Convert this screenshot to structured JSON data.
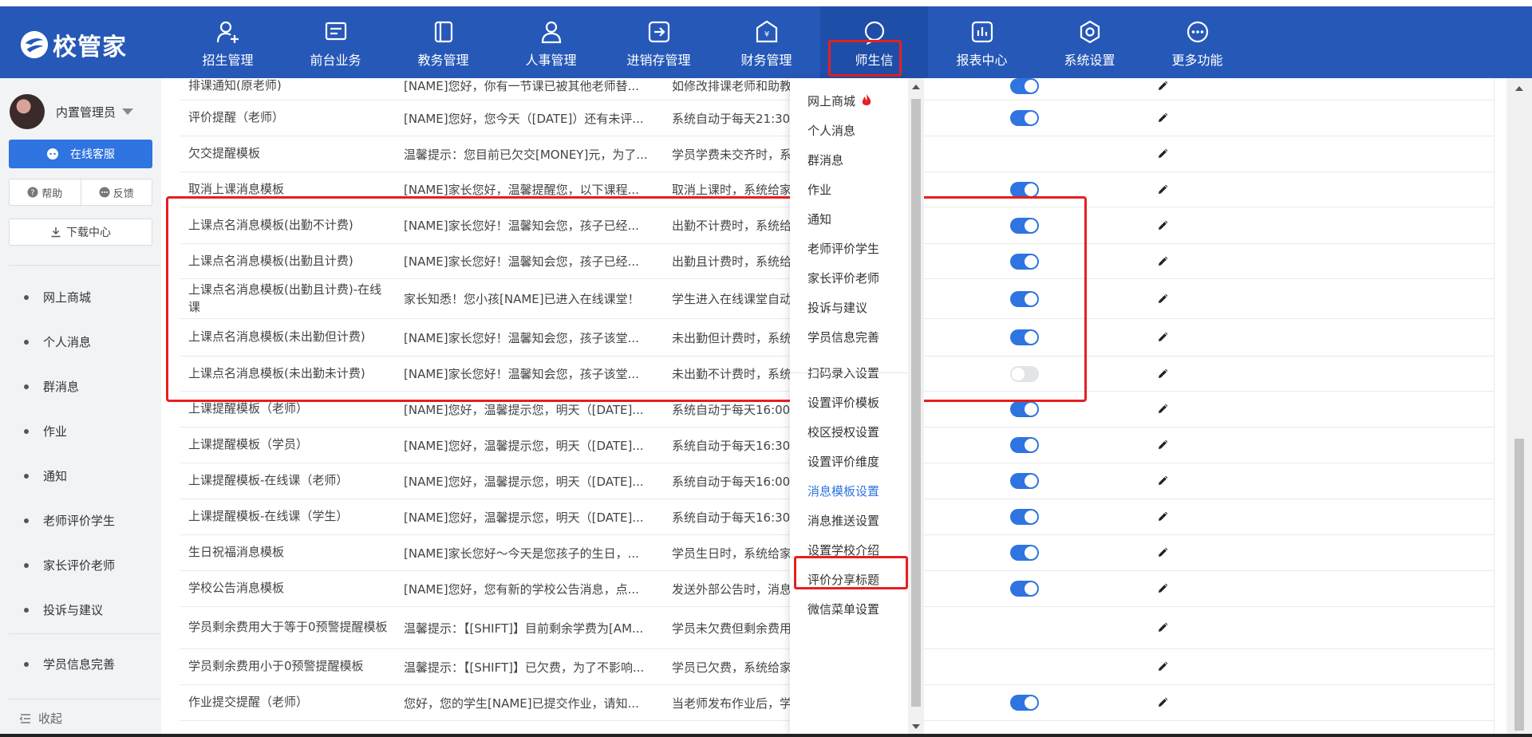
{
  "app": {
    "logo_text": "校管家"
  },
  "nav": {
    "items": [
      {
        "label": "招生管理",
        "icon": "user-add-icon"
      },
      {
        "label": "前台业务",
        "icon": "message-icon"
      },
      {
        "label": "教务管理",
        "icon": "book-icon"
      },
      {
        "label": "人事管理",
        "icon": "person-icon"
      },
      {
        "label": "进销存管理",
        "icon": "inventory-icon"
      },
      {
        "label": "财务管理",
        "icon": "finance-icon"
      },
      {
        "label": "师生信",
        "icon": "chat-icon",
        "active": true
      },
      {
        "label": "报表中心",
        "icon": "report-icon"
      },
      {
        "label": "系统设置",
        "icon": "settings-icon"
      },
      {
        "label": "更多功能",
        "icon": "more-icon"
      }
    ]
  },
  "sidebar": {
    "user_name": "内置管理员",
    "online_service": "在线客服",
    "help": "帮助",
    "feedback": "反馈",
    "download_center": "下载中心",
    "items": [
      "网上商城",
      "个人消息",
      "群消息",
      "作业",
      "通知",
      "老师评价学生",
      "家长评价老师",
      "投诉与建议"
    ],
    "items2": [
      "学员信息完善"
    ],
    "collapse": "收起"
  },
  "table": {
    "rows": [
      {
        "name": "排课通知(原老师)",
        "content": "[NAME]您好，你有一节课已被其他老师替...",
        "desc": "如修改排课老师和助教",
        "toggle": true,
        "edit": true
      },
      {
        "name": "评价提醒（老师）",
        "content": "[NAME]您好，您今天（[DATE]）还有未评...",
        "desc": "系统自动于每天21:30",
        "toggle": true,
        "edit": true
      },
      {
        "name": "欠交提醒模板",
        "content": "温馨提示：您目前已欠交[MONEY]元，为了...",
        "desc": "学员学费未交齐时，系",
        "toggle": null,
        "edit": true
      },
      {
        "name": "取消上课消息模板",
        "content": "[NAME]家长您好，温馨提醒您，以下课程...",
        "desc": "取消上课时，系统给家",
        "toggle": true,
        "edit": true
      },
      {
        "name": "上课点名消息模板(出勤不计费)",
        "content": "[NAME]家长您好！温馨知会您，孩子已经...",
        "desc": "出勤不计费时，系统给",
        "toggle": true,
        "edit": true
      },
      {
        "name": "上课点名消息模板(出勤且计费)",
        "content": "[NAME]家长您好！温馨知会您，孩子已经...",
        "desc": "出勤且计费时，系统给",
        "toggle": true,
        "edit": true
      },
      {
        "name": "上课点名消息模板(出勤且计费)-在线课",
        "content": "家长知悉！您小孩[NAME]已进入在线课堂！",
        "desc": "学生进入在线课堂自动",
        "toggle": true,
        "edit": true
      },
      {
        "name": "上课点名消息模板(未出勤但计费)",
        "content": "[NAME]家长您好！温馨知会您，孩子该堂...",
        "desc": "未出勤但计费时，系统",
        "toggle": true,
        "edit": true
      },
      {
        "name": "上课点名消息模板(未出勤未计费)",
        "content": "[NAME]家长您好！温馨知会您，孩子该堂...",
        "desc": "未出勤不计费时，系统",
        "toggle": false,
        "edit": true
      },
      {
        "name": "上课提醒模板（老师）",
        "content": "[NAME]您好，温馨提示您，明天（[DATE]...",
        "desc": "系统自动于每天16:00",
        "toggle": true,
        "edit": true
      },
      {
        "name": "上课提醒模板（学员）",
        "content": "[NAME]您好，温馨提示您，明天（[DATE]...",
        "desc": "系统自动于每天16:30",
        "toggle": true,
        "edit": true
      },
      {
        "name": "上课提醒模板-在线课（老师）",
        "content": "[NAME]您好，温馨提示您，明天（[DATE]...",
        "desc": "系统自动于每天16:00",
        "toggle": true,
        "edit": true
      },
      {
        "name": "上课提醒模板-在线课（学生）",
        "content": "[NAME]您好，温馨提示您，明天（[DATE]...",
        "desc": "系统自动于每天16:30",
        "toggle": true,
        "edit": true
      },
      {
        "name": "生日祝福消息模板",
        "content": "[NAME]家长您好～今天是您孩子的生日，...",
        "desc": "学员生日时，系统给家",
        "toggle": true,
        "edit": true
      },
      {
        "name": "学校公告消息模板",
        "content": "[NAME]您好，您有新的学校公告消息，点...",
        "desc": "发送外部公告时，消息",
        "toggle": true,
        "edit": true
      },
      {
        "name": "学员剩余费用大于等于0预警提醒模板",
        "content": "温馨提示：【[SHIFT]】目前剩余学费为[AM...",
        "desc": "学员未欠费但剩余费用",
        "toggle": null,
        "edit": true
      },
      {
        "name": "学员剩余费用小于0预警提醒模板",
        "content": "温馨提示：【[SHIFT]】已欠费，为了不影响...",
        "desc": "学员已欠费，系统给家",
        "toggle": null,
        "edit": true
      },
      {
        "name": "作业提交提醒（老师）",
        "content": "您好，您的学生[NAME]已提交作业，请知...",
        "desc": "当老师发布作业后，学",
        "toggle": true,
        "edit": true
      }
    ]
  },
  "dropdown": {
    "items": [
      "网上商城",
      "个人消息",
      "群消息",
      "作业",
      "通知",
      "老师评价学生",
      "家长评价老师",
      "投诉与建议",
      "学员信息完善",
      "扫码录入设置",
      "设置评价模板",
      "校区授权设置",
      "设置评价维度",
      "消息模板设置",
      "消息推送设置",
      "设置学校介绍",
      "评价分享标题",
      "微信菜单设置"
    ],
    "selected": "消息模板设置"
  },
  "colors": {
    "topbar": "#2658b8",
    "accent": "#2f74e0",
    "highlight": "#e52020"
  }
}
